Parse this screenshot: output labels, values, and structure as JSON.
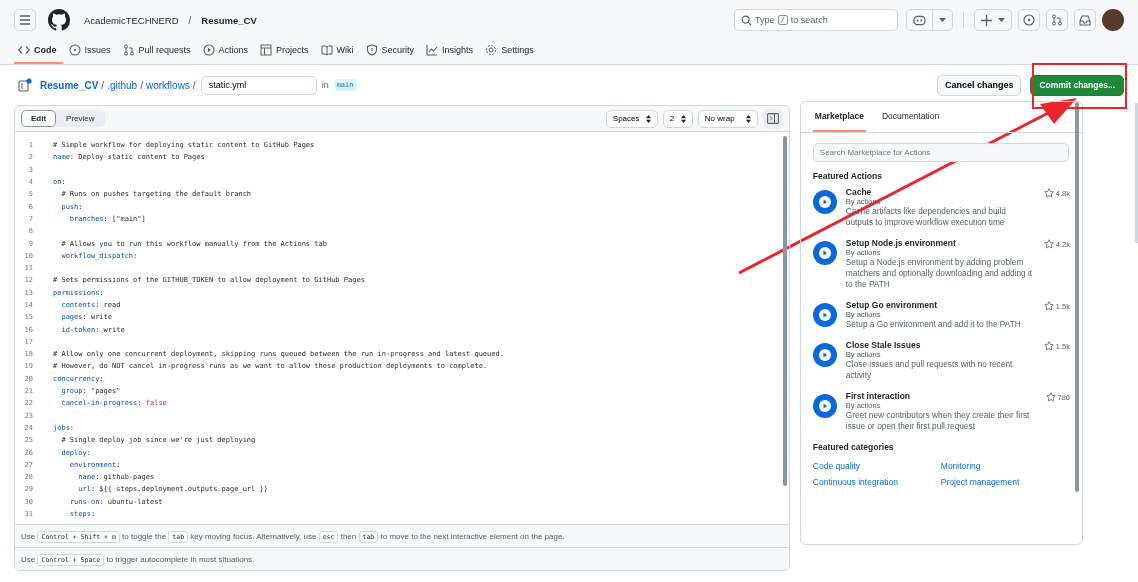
{
  "header": {
    "owner": "AcademicTECHNERD",
    "separator": "/",
    "repo": "Resume_CV",
    "search_placeholder": "Type",
    "search_key": "/",
    "search_suffix": "to search"
  },
  "repo_tabs": [
    {
      "label": "Code",
      "selected": true
    },
    {
      "label": "Issues",
      "selected": false
    },
    {
      "label": "Pull requests",
      "selected": false
    },
    {
      "label": "Actions",
      "selected": false
    },
    {
      "label": "Projects",
      "selected": false
    },
    {
      "label": "Wiki",
      "selected": false
    },
    {
      "label": "Security",
      "selected": false
    },
    {
      "label": "Insights",
      "selected": false
    },
    {
      "label": "Settings",
      "selected": false
    }
  ],
  "breadcrumb": {
    "segments": [
      "Resume_CV",
      "/",
      ".github",
      "/",
      "workflows",
      "/"
    ],
    "filename": "static.yml",
    "in_label": "in",
    "branch": "main"
  },
  "actions": {
    "cancel": "Cancel changes",
    "commit": "Commit changes..."
  },
  "editor": {
    "modes": [
      {
        "label": "Edit",
        "selected": true
      },
      {
        "label": "Preview",
        "selected": false
      }
    ],
    "indent_mode": "Spaces",
    "indent_size": "2",
    "wrap_mode": "No wrap",
    "lines": [
      {
        "num": "1",
        "parts": [
          {
            "kind": "comment",
            "text": "# Simple workflow for deploying static content to GitHub Pages"
          }
        ]
      },
      {
        "num": "2",
        "parts": [
          {
            "kind": "key",
            "text": "name"
          },
          {
            "kind": "plain",
            "text": ": Deploy static content to Pages"
          }
        ]
      },
      {
        "num": "3"
      },
      {
        "num": "4",
        "parts": [
          {
            "kind": "key",
            "text": "on"
          },
          {
            "kind": "plain",
            "text": ":"
          }
        ]
      },
      {
        "num": "5",
        "parts": [
          {
            "kind": "comment",
            "text": "  # Runs on pushes targeting the default branch"
          }
        ]
      },
      {
        "num": "6",
        "parts": [
          {
            "kind": "key",
            "text": "  push"
          },
          {
            "kind": "plain",
            "text": ":"
          }
        ]
      },
      {
        "num": "7",
        "parts": [
          {
            "kind": "key",
            "text": "    branches"
          },
          {
            "kind": "plain",
            "text": ": [\"main\"]"
          }
        ]
      },
      {
        "num": "8"
      },
      {
        "num": "9",
        "parts": [
          {
            "kind": "comment",
            "text": "  # Allows you to run this workflow manually from the Actions tab"
          }
        ]
      },
      {
        "num": "10",
        "parts": [
          {
            "kind": "key",
            "text": "  workflow_dispatch"
          },
          {
            "kind": "plain",
            "text": ":"
          }
        ]
      },
      {
        "num": "11"
      },
      {
        "num": "12",
        "parts": [
          {
            "kind": "comment",
            "text": "# Sets permissions of the GITHUB_TOKEN to allow deployment to GitHub Pages"
          }
        ]
      },
      {
        "num": "13",
        "parts": [
          {
            "kind": "key",
            "text": "permissions"
          },
          {
            "kind": "plain",
            "text": ":"
          }
        ]
      },
      {
        "num": "14",
        "parts": [
          {
            "kind": "key",
            "text": "  contents"
          },
          {
            "kind": "plain",
            "text": ": read"
          }
        ]
      },
      {
        "num": "15",
        "parts": [
          {
            "kind": "key",
            "text": "  pages"
          },
          {
            "kind": "plain",
            "text": ": write"
          }
        ]
      },
      {
        "num": "16",
        "parts": [
          {
            "kind": "key",
            "text": "  id-token"
          },
          {
            "kind": "plain",
            "text": ": write"
          }
        ]
      },
      {
        "num": "17"
      },
      {
        "num": "18",
        "parts": [
          {
            "kind": "comment",
            "text": "# Allow only one concurrent deployment, skipping runs queued between the run in-progress and latest queued."
          }
        ]
      },
      {
        "num": "19",
        "parts": [
          {
            "kind": "comment",
            "text": "# However, do NOT cancel in-progress runs as we want to allow these production deployments to complete."
          }
        ]
      },
      {
        "num": "20",
        "parts": [
          {
            "kind": "key",
            "text": "concurrency"
          },
          {
            "kind": "plain",
            "text": ":"
          }
        ]
      },
      {
        "num": "21",
        "parts": [
          {
            "kind": "key",
            "text": "  group"
          },
          {
            "kind": "plain",
            "text": ": \"pages\""
          }
        ]
      },
      {
        "num": "22",
        "parts": [
          {
            "kind": "key",
            "text": "  cancel-in-progress"
          },
          {
            "kind": "plain",
            "text": ": "
          },
          {
            "kind": "bool",
            "text": "false"
          }
        ]
      },
      {
        "num": "23"
      },
      {
        "num": "24",
        "parts": [
          {
            "kind": "key",
            "text": "jobs"
          },
          {
            "kind": "plain",
            "text": ":"
          }
        ]
      },
      {
        "num": "25",
        "parts": [
          {
            "kind": "comment",
            "text": "  # Single deploy job since we're just deploying"
          }
        ]
      },
      {
        "num": "26",
        "parts": [
          {
            "kind": "key",
            "text": "  deploy"
          },
          {
            "kind": "plain",
            "text": ":"
          }
        ]
      },
      {
        "num": "27",
        "parts": [
          {
            "kind": "key",
            "text": "    environment"
          },
          {
            "kind": "plain",
            "text": ":"
          }
        ]
      },
      {
        "num": "28",
        "parts": [
          {
            "kind": "key",
            "text": "      name"
          },
          {
            "kind": "plain",
            "text": ": github-pages"
          }
        ]
      },
      {
        "num": "29",
        "parts": [
          {
            "kind": "key",
            "text": "      url"
          },
          {
            "kind": "plain",
            "text": ": ${{ steps.deployment.outputs.page_url }}"
          }
        ]
      },
      {
        "num": "30",
        "parts": [
          {
            "kind": "key",
            "text": "    runs-on"
          },
          {
            "kind": "plain",
            "text": ": ubuntu-latest"
          }
        ]
      },
      {
        "num": "31",
        "parts": [
          {
            "kind": "key",
            "text": "    steps"
          },
          {
            "kind": "plain",
            "text": ":"
          }
        ]
      }
    ],
    "hints": [
      [
        {
          "kind": "text",
          "text": "Use"
        },
        {
          "kind": "kbd",
          "text": "Control + Shift + m"
        },
        {
          "kind": "text",
          "text": "to toggle the"
        },
        {
          "kind": "kbd",
          "text": "tab"
        },
        {
          "kind": "text",
          "text": "key moving focus. Alternatively, use"
        },
        {
          "kind": "kbd",
          "text": "esc"
        },
        {
          "kind": "text",
          "text": "then"
        },
        {
          "kind": "kbd",
          "text": "tab"
        },
        {
          "kind": "text",
          "text": "to move to the next interactive element on the page."
        }
      ],
      [
        {
          "kind": "text",
          "text": "Use"
        },
        {
          "kind": "kbd",
          "text": "Control + Space"
        },
        {
          "kind": "text",
          "text": "to trigger autocomplete in most situations."
        }
      ]
    ]
  },
  "side_panel": {
    "tabs": [
      {
        "label": "Marketplace",
        "selected": true
      },
      {
        "label": "Documentation",
        "selected": false
      }
    ],
    "search_placeholder": "Search Marketplace for Actions",
    "featured_title": "Featured Actions",
    "actions": [
      {
        "name": "Cache",
        "author": "By actions",
        "description": "Cache artifacts like dependencies and build outputs to improve workflow execution time",
        "stars": "4.8k"
      },
      {
        "name": "Setup Node.js environment",
        "author": "By actions",
        "description": "Setup a Node.js environment by adding problem matchers and optionally downloading and adding it to the PATH",
        "stars": "4.2k"
      },
      {
        "name": "Setup Go environment",
        "author": "By actions",
        "description": "Setup a Go environment and add it to the PATH",
        "stars": "1.5k"
      },
      {
        "name": "Close Stale Issues",
        "author": "By actions",
        "description": "Close issues and pull requests with no recent activity",
        "stars": "1.5k"
      },
      {
        "name": "First interaction",
        "author": "By actions",
        "description": "Greet new contributors when they create their first issue or open their first pull request",
        "stars": "786"
      }
    ],
    "categories_title": "Featured categories",
    "categories": [
      "Code quality",
      "Monitoring",
      "Continuous integration",
      "Project management"
    ]
  }
}
